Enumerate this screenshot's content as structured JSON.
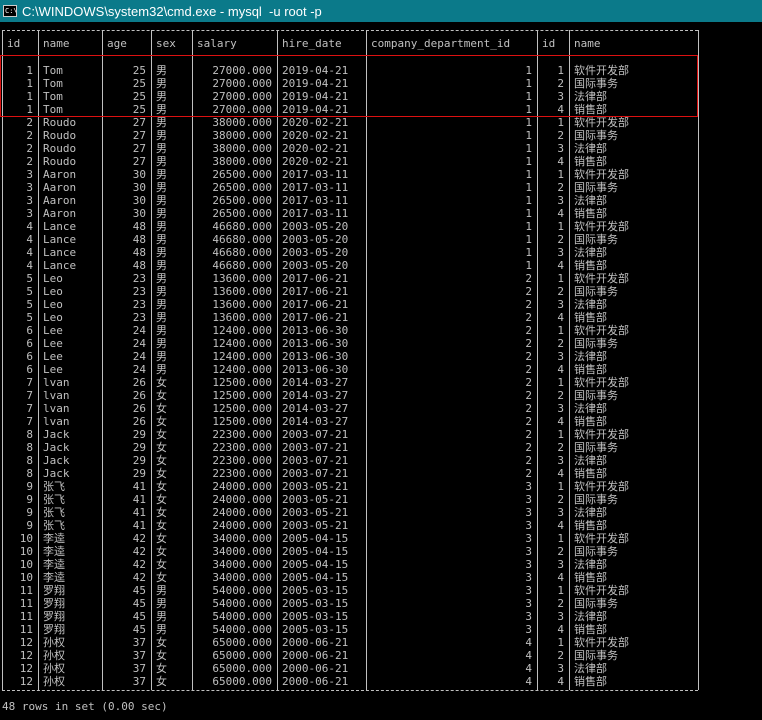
{
  "window": {
    "title": "C:\\WINDOWS\\system32\\cmd.exe - mysql  -u root -p",
    "icon": "cmd-icon",
    "icon_text": "C:\\"
  },
  "table": {
    "columns": [
      "id",
      "name",
      "age",
      "sex",
      "salary",
      "hire_date",
      "company_department_id",
      "id",
      "name"
    ],
    "rows": [
      [
        "1",
        "Tom",
        "25",
        "男",
        "27000.000",
        "2019-04-21",
        "1",
        "1",
        "软件开发部"
      ],
      [
        "1",
        "Tom",
        "25",
        "男",
        "27000.000",
        "2019-04-21",
        "1",
        "2",
        "国际事务"
      ],
      [
        "1",
        "Tom",
        "25",
        "男",
        "27000.000",
        "2019-04-21",
        "1",
        "3",
        "法律部"
      ],
      [
        "1",
        "Tom",
        "25",
        "男",
        "27000.000",
        "2019-04-21",
        "1",
        "4",
        "销售部"
      ],
      [
        "2",
        "Roudo",
        "27",
        "男",
        "38000.000",
        "2020-02-21",
        "1",
        "1",
        "软件开发部"
      ],
      [
        "2",
        "Roudo",
        "27",
        "男",
        "38000.000",
        "2020-02-21",
        "1",
        "2",
        "国际事务"
      ],
      [
        "2",
        "Roudo",
        "27",
        "男",
        "38000.000",
        "2020-02-21",
        "1",
        "3",
        "法律部"
      ],
      [
        "2",
        "Roudo",
        "27",
        "男",
        "38000.000",
        "2020-02-21",
        "1",
        "4",
        "销售部"
      ],
      [
        "3",
        "Aaron",
        "30",
        "男",
        "26500.000",
        "2017-03-11",
        "1",
        "1",
        "软件开发部"
      ],
      [
        "3",
        "Aaron",
        "30",
        "男",
        "26500.000",
        "2017-03-11",
        "1",
        "2",
        "国际事务"
      ],
      [
        "3",
        "Aaron",
        "30",
        "男",
        "26500.000",
        "2017-03-11",
        "1",
        "3",
        "法律部"
      ],
      [
        "3",
        "Aaron",
        "30",
        "男",
        "26500.000",
        "2017-03-11",
        "1",
        "4",
        "销售部"
      ],
      [
        "4",
        "Lance",
        "48",
        "男",
        "46680.000",
        "2003-05-20",
        "1",
        "1",
        "软件开发部"
      ],
      [
        "4",
        "Lance",
        "48",
        "男",
        "46680.000",
        "2003-05-20",
        "1",
        "2",
        "国际事务"
      ],
      [
        "4",
        "Lance",
        "48",
        "男",
        "46680.000",
        "2003-05-20",
        "1",
        "3",
        "法律部"
      ],
      [
        "4",
        "Lance",
        "48",
        "男",
        "46680.000",
        "2003-05-20",
        "1",
        "4",
        "销售部"
      ],
      [
        "5",
        "Leo",
        "23",
        "男",
        "13600.000",
        "2017-06-21",
        "2",
        "1",
        "软件开发部"
      ],
      [
        "5",
        "Leo",
        "23",
        "男",
        "13600.000",
        "2017-06-21",
        "2",
        "2",
        "国际事务"
      ],
      [
        "5",
        "Leo",
        "23",
        "男",
        "13600.000",
        "2017-06-21",
        "2",
        "3",
        "法律部"
      ],
      [
        "5",
        "Leo",
        "23",
        "男",
        "13600.000",
        "2017-06-21",
        "2",
        "4",
        "销售部"
      ],
      [
        "6",
        "Lee",
        "24",
        "男",
        "12400.000",
        "2013-06-30",
        "2",
        "1",
        "软件开发部"
      ],
      [
        "6",
        "Lee",
        "24",
        "男",
        "12400.000",
        "2013-06-30",
        "2",
        "2",
        "国际事务"
      ],
      [
        "6",
        "Lee",
        "24",
        "男",
        "12400.000",
        "2013-06-30",
        "2",
        "3",
        "法律部"
      ],
      [
        "6",
        "Lee",
        "24",
        "男",
        "12400.000",
        "2013-06-30",
        "2",
        "4",
        "销售部"
      ],
      [
        "7",
        "lvan",
        "26",
        "女",
        "12500.000",
        "2014-03-27",
        "2",
        "1",
        "软件开发部"
      ],
      [
        "7",
        "lvan",
        "26",
        "女",
        "12500.000",
        "2014-03-27",
        "2",
        "2",
        "国际事务"
      ],
      [
        "7",
        "lvan",
        "26",
        "女",
        "12500.000",
        "2014-03-27",
        "2",
        "3",
        "法律部"
      ],
      [
        "7",
        "lvan",
        "26",
        "女",
        "12500.000",
        "2014-03-27",
        "2",
        "4",
        "销售部"
      ],
      [
        "8",
        "Jack",
        "29",
        "女",
        "22300.000",
        "2003-07-21",
        "2",
        "1",
        "软件开发部"
      ],
      [
        "8",
        "Jack",
        "29",
        "女",
        "22300.000",
        "2003-07-21",
        "2",
        "2",
        "国际事务"
      ],
      [
        "8",
        "Jack",
        "29",
        "女",
        "22300.000",
        "2003-07-21",
        "2",
        "3",
        "法律部"
      ],
      [
        "8",
        "Jack",
        "29",
        "女",
        "22300.000",
        "2003-07-21",
        "2",
        "4",
        "销售部"
      ],
      [
        "9",
        "张飞",
        "41",
        "女",
        "24000.000",
        "2003-05-21",
        "3",
        "1",
        "软件开发部"
      ],
      [
        "9",
        "张飞",
        "41",
        "女",
        "24000.000",
        "2003-05-21",
        "3",
        "2",
        "国际事务"
      ],
      [
        "9",
        "张飞",
        "41",
        "女",
        "24000.000",
        "2003-05-21",
        "3",
        "3",
        "法律部"
      ],
      [
        "9",
        "张飞",
        "41",
        "女",
        "24000.000",
        "2003-05-21",
        "3",
        "4",
        "销售部"
      ],
      [
        "10",
        "李逵",
        "42",
        "女",
        "34000.000",
        "2005-04-15",
        "3",
        "1",
        "软件开发部"
      ],
      [
        "10",
        "李逵",
        "42",
        "女",
        "34000.000",
        "2005-04-15",
        "3",
        "2",
        "国际事务"
      ],
      [
        "10",
        "李逵",
        "42",
        "女",
        "34000.000",
        "2005-04-15",
        "3",
        "3",
        "法律部"
      ],
      [
        "10",
        "李逵",
        "42",
        "女",
        "34000.000",
        "2005-04-15",
        "3",
        "4",
        "销售部"
      ],
      [
        "11",
        "罗翔",
        "45",
        "男",
        "54000.000",
        "2005-03-15",
        "3",
        "1",
        "软件开发部"
      ],
      [
        "11",
        "罗翔",
        "45",
        "男",
        "54000.000",
        "2005-03-15",
        "3",
        "2",
        "国际事务"
      ],
      [
        "11",
        "罗翔",
        "45",
        "男",
        "54000.000",
        "2005-03-15",
        "3",
        "3",
        "法律部"
      ],
      [
        "11",
        "罗翔",
        "45",
        "男",
        "54000.000",
        "2005-03-15",
        "3",
        "4",
        "销售部"
      ],
      [
        "12",
        "孙权",
        "37",
        "女",
        "65000.000",
        "2000-06-21",
        "4",
        "1",
        "软件开发部"
      ],
      [
        "12",
        "孙权",
        "37",
        "女",
        "65000.000",
        "2000-06-21",
        "4",
        "2",
        "国际事务"
      ],
      [
        "12",
        "孙权",
        "37",
        "女",
        "65000.000",
        "2000-06-21",
        "4",
        "3",
        "法律部"
      ],
      [
        "12",
        "孙权",
        "37",
        "女",
        "65000.000",
        "2000-06-21",
        "4",
        "4",
        "销售部"
      ]
    ]
  },
  "status_line": "48 rows in set (0.00 sec)",
  "colors": {
    "titlebar": "#0b7a8a",
    "background": "#000000",
    "text": "#c0c0c0",
    "highlight_box": "#dd1111"
  }
}
